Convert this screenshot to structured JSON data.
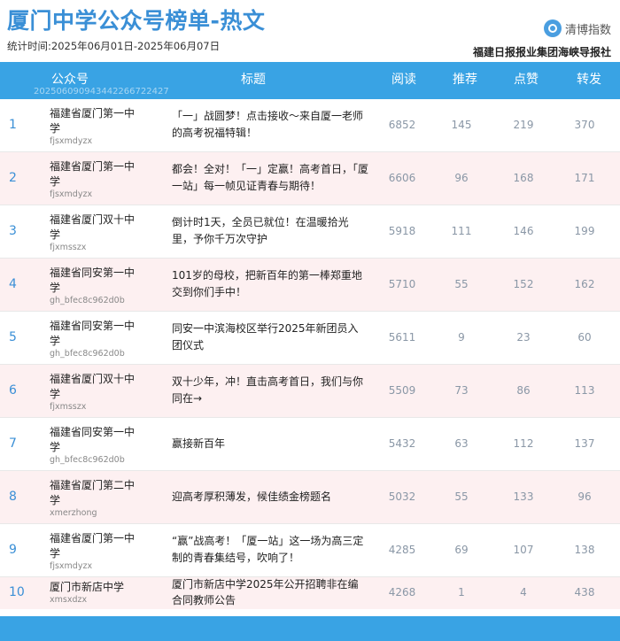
{
  "header": {
    "title": "厦门中学公众号榜单-热文",
    "period": "统计时间:2025年06月01日-2025年06月07日",
    "brand_name": "清博指数",
    "publisher": "福建日报报业集团海峡导报社"
  },
  "columns": {
    "account": "公众号",
    "headline": "标题",
    "reads": "阅读",
    "recommends": "推荐",
    "likes": "点赞",
    "shares": "转发"
  },
  "timestamp_code": "20250609094344226672242​7",
  "rows": [
    {
      "rank": "1",
      "name": "福建省厦门第一中学",
      "id": "fjsxmdyzx",
      "title": "「一」战圆梦！点击接收～来自厦一老师的高考祝福特辑！",
      "reads": "6852",
      "recommends": "145",
      "likes": "219",
      "shares": "370"
    },
    {
      "rank": "2",
      "name": "福建省厦门第一中学",
      "id": "fjsxmdyzx",
      "title": "都会！全对！「一」定赢！高考首日，「厦一站」每一帧见证青春与期待！",
      "reads": "6606",
      "recommends": "96",
      "likes": "168",
      "shares": "171"
    },
    {
      "rank": "3",
      "name": "福建省厦门双十中学",
      "id": "fjxmsszx",
      "title": "倒计时1天，全员已就位！在温暖拾光里，予你千万次守护",
      "reads": "5918",
      "recommends": "111",
      "likes": "146",
      "shares": "199"
    },
    {
      "rank": "4",
      "name": "福建省同安第一中学",
      "id": "gh_bfec8c962d0b",
      "title": "101岁的母校，把新百年的第一棒郑重地交到你们手中！",
      "reads": "5710",
      "recommends": "55",
      "likes": "152",
      "shares": "162"
    },
    {
      "rank": "5",
      "name": "福建省同安第一中学",
      "id": "gh_bfec8c962d0b",
      "title": "同安一中滨海校区举行2025年新团员入团仪式",
      "reads": "5611",
      "recommends": "9",
      "likes": "23",
      "shares": "60"
    },
    {
      "rank": "6",
      "name": "福建省厦门双十中学",
      "id": "fjxmsszx",
      "title": "双十少年，冲！直击高考首日，我们与你同在→",
      "reads": "5509",
      "recommends": "73",
      "likes": "86",
      "shares": "113"
    },
    {
      "rank": "7",
      "name": "福建省同安第一中学",
      "id": "gh_bfec8c962d0b",
      "title": "赢接新百年",
      "reads": "5432",
      "recommends": "63",
      "likes": "112",
      "shares": "137"
    },
    {
      "rank": "8",
      "name": "福建省厦门第二中学",
      "id": "xmerzhong",
      "title": "迎高考厚积薄发，候佳绩金榜题名",
      "reads": "5032",
      "recommends": "55",
      "likes": "133",
      "shares": "96"
    },
    {
      "rank": "9",
      "name": "福建省厦门第一中学",
      "id": "fjsxmdyzx",
      "title": "“赢”战高考！「厦一站」这一场为高三定制的青春集结号，吹响了！",
      "reads": "4285",
      "recommends": "69",
      "likes": "107",
      "shares": "138"
    },
    {
      "rank": "10",
      "name": "厦门市新店中学",
      "id": "xmsxdzx",
      "title": "厦门市新店中学2025年公开招聘非在编合同教师公告",
      "reads": "4268",
      "recommends": "1",
      "likes": "4",
      "shares": "438"
    }
  ]
}
